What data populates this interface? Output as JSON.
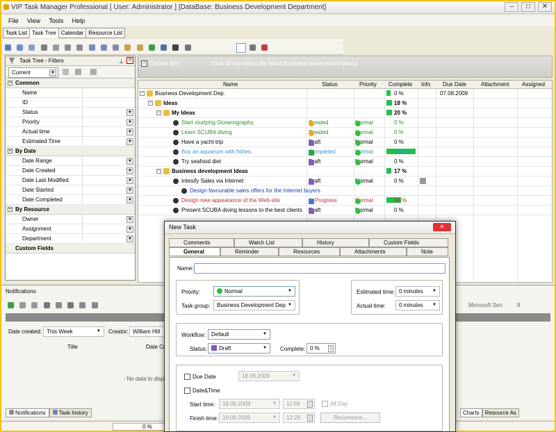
{
  "app": {
    "title": "VIP Task Manager Professional [ User: Administrator ] [DataBase: Business Development Department]"
  },
  "menu": [
    "File",
    "View",
    "Tools",
    "Help"
  ],
  "tabs": [
    "Task List",
    "Task Tree",
    "Calendar",
    "Resource List"
  ],
  "left_panel": {
    "title": "Task Tree - Filters",
    "current": "Current",
    "groups": [
      {
        "name": "Common",
        "props": [
          {
            "label": "Name",
            "dd": false
          },
          {
            "label": "ID",
            "dd": false
          },
          {
            "label": "Status",
            "dd": true
          },
          {
            "label": "Priority",
            "dd": true
          },
          {
            "label": "Actual time",
            "dd": true
          },
          {
            "label": "Estimated Time",
            "dd": true
          }
        ]
      },
      {
        "name": "By Date",
        "props": [
          {
            "label": "Date Range",
            "dd": true
          },
          {
            "label": "Date Created",
            "dd": true
          },
          {
            "label": "Date Last Modified",
            "dd": true
          },
          {
            "label": "Date Started",
            "dd": true
          },
          {
            "label": "Date Completed",
            "dd": true
          }
        ]
      },
      {
        "name": "By Resource",
        "props": [
          {
            "label": "Owner",
            "dd": true
          },
          {
            "label": "Assignment",
            "dd": true
          },
          {
            "label": "Department",
            "dd": true
          }
        ]
      },
      {
        "name": "Custom Fields",
        "props": []
      }
    ]
  },
  "filter": {
    "label": "Current filter:",
    "value": "(Task Group  (Ideas,My Ideas,Business development ideas))"
  },
  "grid": {
    "columns": [
      "Name",
      "Status",
      "Priority",
      "Complete",
      "Info",
      "Due Date",
      "Attachment",
      "Assigned"
    ],
    "rows": [
      {
        "name": "Business Development Dep.",
        "indent": 0,
        "bold": false,
        "color": "#000000",
        "status": "",
        "priority": "",
        "complete": "0 %",
        "bar": 0.15,
        "due": "07.08.2009"
      },
      {
        "name": "Ideas",
        "indent": 1,
        "bold": true,
        "color": "#000000",
        "status": "",
        "priority": "",
        "complete": "18 %",
        "bar": 0.18,
        "due": ""
      },
      {
        "name": "My Ideas",
        "indent": 2,
        "bold": true,
        "color": "#000000",
        "status": "",
        "priority": "",
        "complete": "20 %",
        "bar": 0.2,
        "due": ""
      },
      {
        "name": "Start studying Oceanography",
        "indent": 3,
        "bold": false,
        "color": "#2e8b2e",
        "status": "Created",
        "priority": "Normal",
        "complete": "0 %",
        "bar": 0,
        "due": ""
      },
      {
        "name": "Learn SCUBA diving",
        "indent": 3,
        "bold": false,
        "color": "#2e8b2e",
        "status": "Created",
        "priority": "Normal",
        "complete": "0 %",
        "bar": 0,
        "due": ""
      },
      {
        "name": "Have a yacht trip",
        "indent": 3,
        "bold": false,
        "color": "#000000",
        "status": "Draft",
        "priority": "Normal",
        "complete": "0 %",
        "bar": 0,
        "due": ""
      },
      {
        "name": "Buy an aquarium with fishes",
        "indent": 3,
        "bold": false,
        "color": "#3c8fd0",
        "status": "Completed",
        "priority": "Normal",
        "complete": "100 %",
        "bar": 1.0,
        "due": ""
      },
      {
        "name": "Try seafood diet",
        "indent": 3,
        "bold": false,
        "color": "#000000",
        "status": "Draft",
        "priority": "Normal",
        "complete": "0 %",
        "bar": 0,
        "due": ""
      },
      {
        "name": "Business development Ideas",
        "indent": 2,
        "bold": true,
        "color": "#000000",
        "status": "",
        "priority": "",
        "complete": "17 %",
        "bar": 0.17,
        "due": ""
      },
      {
        "name": "Intesify Sales via Internet",
        "indent": 3,
        "bold": false,
        "color": "#000000",
        "status": "Draft",
        "priority": "Normal",
        "complete": "0 %",
        "bar": 0,
        "due": ""
      },
      {
        "name": "Design favourable sales offers for the Internet buyers",
        "indent": 4,
        "bold": false,
        "color": "#1a3da8",
        "status": "",
        "priority": "",
        "complete": "",
        "bar": 0,
        "due": ""
      },
      {
        "name": "Design new appearance of the Web-site",
        "indent": 3,
        "bold": false,
        "color": "#c03030",
        "status": "In Progress",
        "priority": "Normal",
        "complete": "50 %",
        "bar": 0.5,
        "due": ""
      },
      {
        "name": "Present SCUBA diving lessons to the best clients",
        "indent": 3,
        "bold": false,
        "color": "#000000",
        "status": "Draft",
        "priority": "Normal",
        "complete": "0 %",
        "bar": 0,
        "due": ""
      }
    ]
  },
  "notifications": {
    "title": "Notifications",
    "date_created_label": "Date created:",
    "date_created": "This Week",
    "creator_label": "Creator:",
    "creator": "William Hill",
    "col_title": "Title",
    "col_date": "Date Cr",
    "empty": ": No data to displa",
    "tabs": [
      "Notifications",
      "Task history"
    ],
    "font": "Microsoft Sen",
    "size": "8",
    "right_tabs": [
      "Charts",
      "Resource As"
    ]
  },
  "status_bar": {
    "progress": "0 %"
  },
  "dialog": {
    "title": "New Task",
    "tabs_top": [
      "Comments",
      "Watch List",
      "History",
      "Custom Fields"
    ],
    "tabs_bottom": [
      "General",
      "Reminder",
      "Resources",
      "Attachments",
      "Note"
    ],
    "name_label": "Name:",
    "priority_label": "Priority:",
    "priority": "Normal",
    "group_label": "Task group:",
    "group": "Business Development Dep.",
    "est_label": "Estimated time:",
    "est": "0 minutes",
    "act_label": "Actual time:",
    "act": "0 minutes",
    "workflow_label": "Workflow:",
    "workflow": "Default",
    "status_label": "Status:",
    "status": "Draft",
    "complete_label": "Complete:",
    "complete": "0 %",
    "due_label": "Due Date",
    "due": "18.06.2009",
    "datetime_label": "Date&Time",
    "start_label": "Start time:",
    "start_date": "18.06.2009",
    "start_time": "11:58",
    "allday_label": "All Day",
    "finish_label": "Finish time:",
    "finish_date": "19.06.2009",
    "finish_time": "12:28",
    "recurrence": "Recurrence..."
  }
}
